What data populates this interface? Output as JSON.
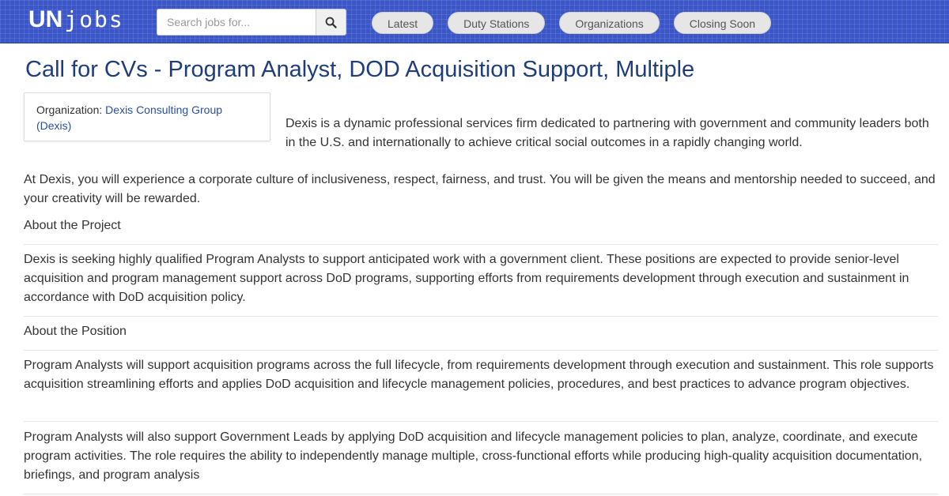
{
  "header": {
    "logo_un": "UN",
    "logo_jobs": "jobs",
    "search_placeholder": "Search jobs for...",
    "search_icon": "search-icon",
    "nav": [
      "Latest",
      "Duty Stations",
      "Organizations",
      "Closing Soon"
    ]
  },
  "job": {
    "title": "Call for CVs - Program Analyst, DOD Acquisition Support, Multiple",
    "org_label": "Organization: ",
    "org_name": "Dexis Consulting Group (Dexis)",
    "intro": "Dexis is a dynamic professional services firm dedicated to partnering with government and community leaders both in the U.S. and internationally to achieve critical social outcomes in a rapidly changing world.",
    "culture": "At Dexis, you will experience a corporate culture of inclusiveness, respect, fairness, and trust. You will be given the means and mentorship needed to succeed, and your creativity will be rewarded.",
    "about_project_heading": "About the Project",
    "about_project": "Dexis is seeking highly qualified Program Analysts to support anticipated work with a government client. These positions are expected to provide senior-level acquisition and program management support across DoD programs, supporting efforts from requirements development through execution and sustainment in accordance with DoD acquisition policy.",
    "about_position_heading": "About the Position",
    "position_p1": "Program Analysts will support acquisition programs across the full lifecycle, from requirements development through execution and sustainment. This role supports acquisition streamlining efforts and applies DoD acquisition and lifecycle management policies, procedures, and best practices to advance program objectives.",
    "position_p2": "Program Analysts will also support Government Leads by applying DoD acquisition and lifecycle management policies to plan, analyze, coordinate, and execute program activities. The role requires the ability to independently manage multiple, cross-functional efforts while producing high-quality acquisition documentation, briefings, and program analysis"
  },
  "colors": {
    "header_bg": "#3a56c8",
    "title": "#1f3d7a",
    "link": "#2a4f9e"
  }
}
